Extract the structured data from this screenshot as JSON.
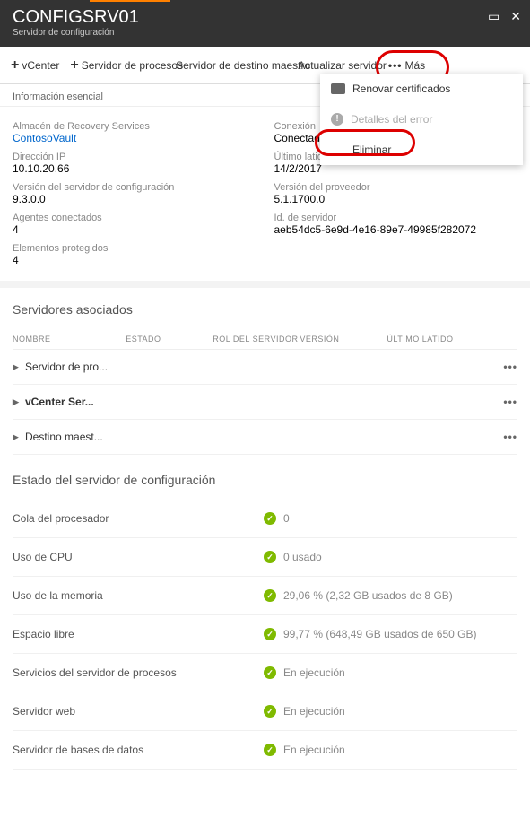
{
  "header": {
    "title": "CONFIGSRV01",
    "subtitle": "Servidor de configuración"
  },
  "toolbar": {
    "vcenter": "vCenter",
    "process_server": "Servidor de procesos",
    "master_target": "Servidor de destino maestro",
    "refresh": "Actualizar servidor",
    "more": "Más"
  },
  "dropdown": {
    "renew": "Renovar certificados",
    "error_details": "Detalles del error",
    "delete": "Eliminar"
  },
  "info_essential": "Información esencial",
  "essential": {
    "left": {
      "vault_label": "Almacén de Recovery Services",
      "vault": "ContosoVault",
      "ip_label": "Dirección IP",
      "ip": "10.10.20.66",
      "cfg_ver_label": "Versión del servidor de configuración",
      "cfg_ver": "9.3.0.0",
      "agents_label": "Agentes conectados",
      "agents": "4",
      "protected_label": "Elementos protegidos",
      "protected": "4"
    },
    "right": {
      "conn_label": "Conexión",
      "conn": "Conectado",
      "heartbeat_label": "Último latido",
      "heartbeat": "14/2/2017",
      "provider_label": "Versión del proveedor",
      "provider": "5.1.1700.0",
      "sid_label": "Id. de servidor",
      "sid": "aeb54dc5-6e9d-4e16-89e7-49985f282072"
    }
  },
  "associated": {
    "title": "Servidores asociados",
    "headers": {
      "name": "NOMBRE",
      "state": "ESTADO",
      "role": "ROL DEL SERVIDOR",
      "version": "VERSIÓN",
      "heartbeat": "ÚLTIMO LATIDO"
    },
    "rows": [
      "Servidor de pro...",
      "vCenter Ser...",
      "Destino maest..."
    ]
  },
  "health": {
    "title": "Estado del servidor de configuración",
    "items": [
      {
        "name": "Cola del procesador",
        "value": "0"
      },
      {
        "name": "Uso de CPU",
        "value": "0 usado"
      },
      {
        "name": "Uso de la memoria",
        "value": "29,06 % (2,32 GB usados de 8 GB)"
      },
      {
        "name": "Espacio libre",
        "value": "99,77 % (648,49 GB usados de 650 GB)"
      },
      {
        "name": "Servicios del servidor de procesos",
        "value": "En ejecución"
      },
      {
        "name": "Servidor web",
        "value": "En ejecución"
      },
      {
        "name": "Servidor de bases de datos",
        "value": "En ejecución"
      }
    ]
  }
}
